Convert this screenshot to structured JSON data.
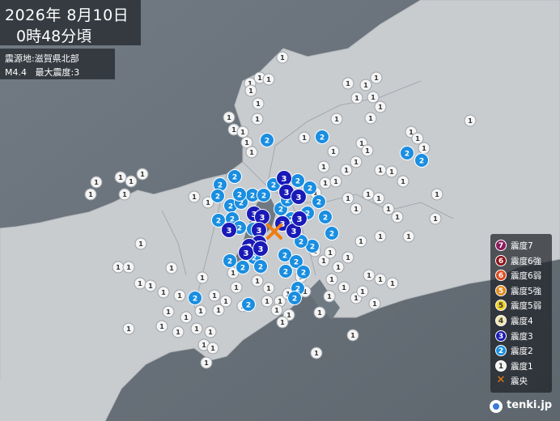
{
  "header": {
    "date": "2026年 8月10日",
    "time": "0時48分頃"
  },
  "info": {
    "epicenter": "震源地:滋賀県北部",
    "magnitude": "M4.4",
    "max_intensity": "最大震度:3"
  },
  "legend": [
    {
      "key": "7",
      "label": "震度7",
      "color": "#8a1c5c"
    },
    {
      "key": "6+",
      "label": "震度6強",
      "color": "#8b1218"
    },
    {
      "key": "6-",
      "label": "震度6弱",
      "color": "#e04a20"
    },
    {
      "key": "5+",
      "label": "震度5強",
      "color": "#e08a1a"
    },
    {
      "key": "5-",
      "label": "震度5弱",
      "color": "#f2d22a"
    },
    {
      "key": "4",
      "label": "震度4",
      "color": "#efe7b0"
    },
    {
      "key": "3",
      "label": "震度3",
      "color": "#1a1ab8"
    },
    {
      "key": "2",
      "label": "震度2",
      "color": "#1a8ee0"
    },
    {
      "key": "1",
      "label": "震度1",
      "color": "#f4f4f4"
    },
    {
      "key": "x",
      "label": "震央",
      "color": "#f07d12"
    }
  ],
  "credit": "tenki.jp",
  "map": {
    "epicenter_icon": "epicenter-cross-icon",
    "stations_intensity_3_count": 14,
    "stations_intensity_2_count": 40
  }
}
